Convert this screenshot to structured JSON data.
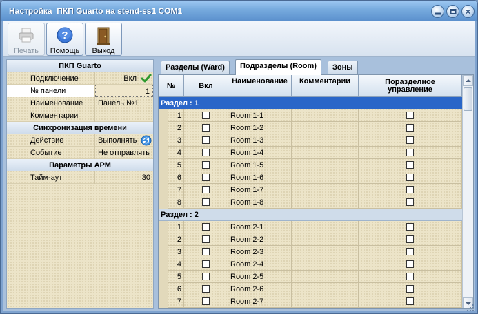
{
  "window": {
    "title": "Настройка  ПКП Guarto на stend-ss1 COM1"
  },
  "toolbar": {
    "print_label": "Печать",
    "help_label": "Помощь",
    "exit_label": "Выход"
  },
  "properties": {
    "group1_title": "ПКП Guarto",
    "connection_label": "Подключение",
    "connection_value": "Вкл",
    "panel_no_label": "№ панели",
    "panel_no_value": "1",
    "name_label": "Наименование",
    "name_value": "Панель №1",
    "comments_label": "Комментарии",
    "comments_value": "",
    "group2_title": "Синхронизация времени",
    "action_label": "Действие",
    "action_value": "Выполнять",
    "event_label": "Событие",
    "event_value": "Не отправлять",
    "group3_title": "Параметры АРМ",
    "timeout_label": "Тайм-аут",
    "timeout_value": "30"
  },
  "tabs": [
    {
      "label": "Разделы (Ward)"
    },
    {
      "label": "Подразделы (Room)"
    },
    {
      "label": "Зоны"
    }
  ],
  "grid": {
    "columns": {
      "no": "№",
      "on": "Вкл",
      "name": "Наименование",
      "comments": "Комментарии",
      "separate": "Поразделное управление"
    },
    "sections": [
      {
        "label": "Раздел : 1",
        "rows": [
          {
            "no": "1",
            "name": "Room 1-1"
          },
          {
            "no": "2",
            "name": "Room 1-2"
          },
          {
            "no": "3",
            "name": "Room 1-3"
          },
          {
            "no": "4",
            "name": "Room 1-4"
          },
          {
            "no": "5",
            "name": "Room 1-5"
          },
          {
            "no": "6",
            "name": "Room 1-6"
          },
          {
            "no": "7",
            "name": "Room 1-7"
          },
          {
            "no": "8",
            "name": "Room 1-8"
          }
        ]
      },
      {
        "label": "Раздел : 2",
        "rows": [
          {
            "no": "1",
            "name": "Room 2-1"
          },
          {
            "no": "2",
            "name": "Room 2-2"
          },
          {
            "no": "3",
            "name": "Room 2-3"
          },
          {
            "no": "4",
            "name": "Room 2-4"
          },
          {
            "no": "5",
            "name": "Room 2-5"
          },
          {
            "no": "6",
            "name": "Room 2-6"
          },
          {
            "no": "7",
            "name": "Room 2-7"
          }
        ]
      }
    ]
  },
  "colors": {
    "selected_section": "#2a66c8",
    "panel_background": "#ece4c8",
    "window_frame": "#7fa3cf"
  },
  "icons": {
    "print": "printer-icon",
    "help": "help-icon",
    "exit": "exit-door-icon",
    "connection": "checkmark-icon",
    "action": "sync-icon"
  }
}
